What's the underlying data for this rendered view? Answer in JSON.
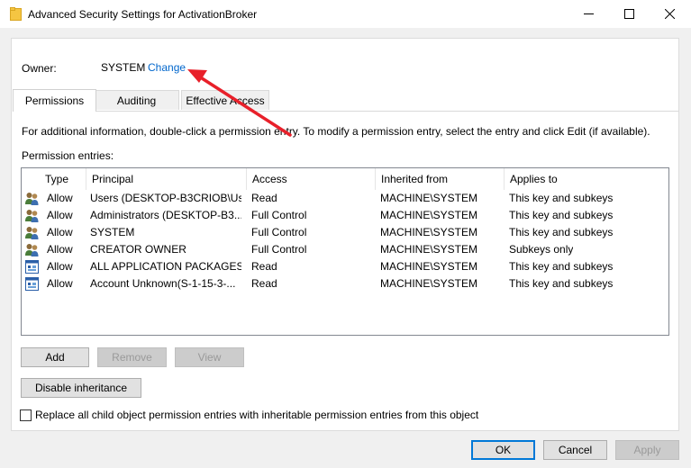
{
  "window": {
    "title": "Advanced Security Settings for ActivationBroker",
    "icon": "folder-icon",
    "controls": [
      "minimize-icon",
      "maximize-icon",
      "close-icon"
    ]
  },
  "owner": {
    "label": "Owner:",
    "value": "SYSTEM",
    "change_link": "Change"
  },
  "tabs": [
    {
      "label": "Permissions",
      "active": true
    },
    {
      "label": "Auditing",
      "active": false
    },
    {
      "label": "Effective Access",
      "active": false
    }
  ],
  "info_text": "For additional information, double-click a permission entry. To modify a permission entry, select the entry and click Edit (if available).",
  "entries_label": "Permission entries:",
  "table": {
    "columns": [
      "Type",
      "Principal",
      "Access",
      "Inherited from",
      "Applies to"
    ],
    "rows": [
      {
        "icon": "users-icon",
        "type": "Allow",
        "principal": "Users (DESKTOP-B3CRIOB\\Us...",
        "access": "Read",
        "inherited": "MACHINE\\SYSTEM",
        "applies": "This key and subkeys"
      },
      {
        "icon": "users-icon",
        "type": "Allow",
        "principal": "Administrators (DESKTOP-B3...",
        "access": "Full Control",
        "inherited": "MACHINE\\SYSTEM",
        "applies": "This key and subkeys"
      },
      {
        "icon": "users-icon",
        "type": "Allow",
        "principal": "SYSTEM",
        "access": "Full Control",
        "inherited": "MACHINE\\SYSTEM",
        "applies": "This key and subkeys"
      },
      {
        "icon": "users-icon",
        "type": "Allow",
        "principal": "CREATOR OWNER",
        "access": "Full Control",
        "inherited": "MACHINE\\SYSTEM",
        "applies": "Subkeys only"
      },
      {
        "icon": "app-package-icon",
        "type": "Allow",
        "principal": "ALL APPLICATION PACKAGES",
        "access": "Read",
        "inherited": "MACHINE\\SYSTEM",
        "applies": "This key and subkeys"
      },
      {
        "icon": "app-package-icon",
        "type": "Allow",
        "principal": "Account Unknown(S-1-15-3-...",
        "access": "Read",
        "inherited": "MACHINE\\SYSTEM",
        "applies": "This key and subkeys"
      }
    ]
  },
  "buttons": {
    "add": "Add",
    "remove": "Remove",
    "view": "View",
    "disable_inheritance": "Disable inheritance",
    "ok": "OK",
    "cancel": "Cancel",
    "apply": "Apply"
  },
  "replace_checkbox": {
    "label": "Replace all child object permission entries with inheritable permission entries from this object",
    "checked": false
  },
  "colors": {
    "link": "#0066cc",
    "annotation_arrow": "#e8202a",
    "default_button_border": "#0078d7"
  }
}
